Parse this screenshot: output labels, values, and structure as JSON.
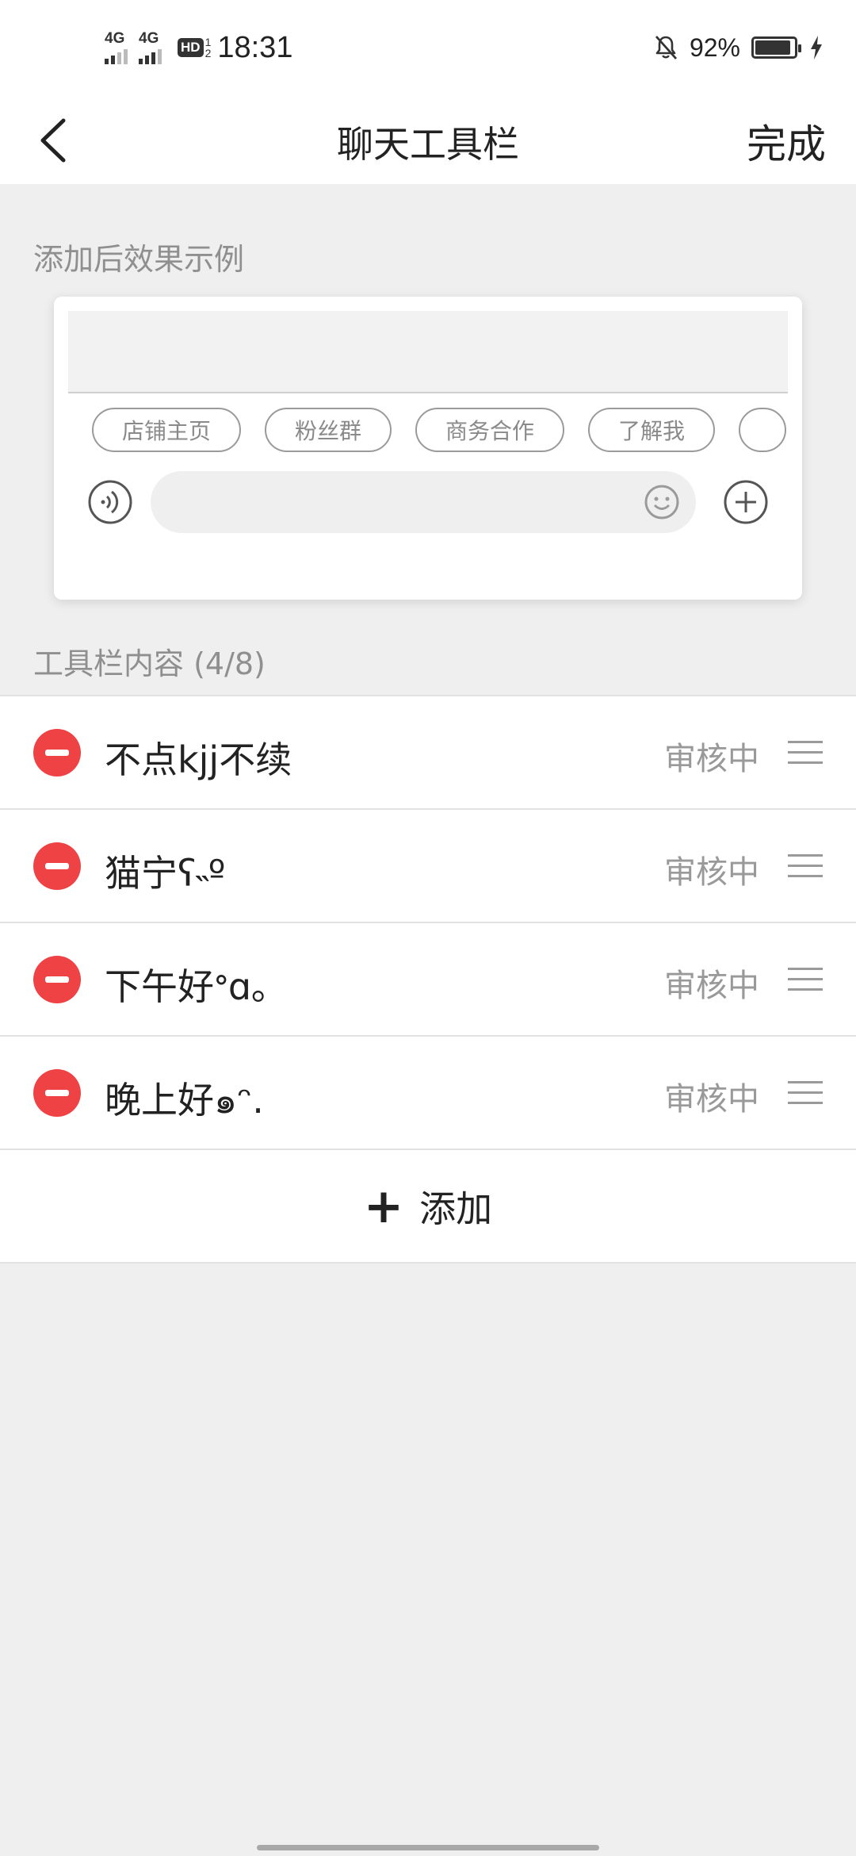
{
  "status_bar": {
    "signal1_label": "4G",
    "signal2_label": "4G",
    "hd_label": "HD",
    "hd_fraction_top": "1",
    "hd_fraction_bottom": "2",
    "time": "18:31",
    "battery_percent": "92%",
    "icons": [
      "bell-off-icon",
      "battery-icon",
      "charging-icon"
    ]
  },
  "nav": {
    "title": "聊天工具栏",
    "done_label": "完成",
    "back_icon": "chevron-left-icon"
  },
  "preview": {
    "section_label": "添加后效果示例",
    "chips": [
      "店铺主页",
      "粉丝群",
      "商务合作",
      "了解我"
    ]
  },
  "toolbar_content": {
    "section_label": "工具栏内容 (4/8)",
    "items": [
      {
        "label": "不点kjj不续",
        "status": "审核中"
      },
      {
        "label": "猫宁ʕ˵º",
        "status": "审核中"
      },
      {
        "label": "下午好ᐤɑ｡",
        "status": "审核中"
      },
      {
        "label": "晚上好๑ᵔ.",
        "status": "审核中"
      }
    ],
    "add_label": "添加"
  },
  "colors": {
    "delete_red": "#ee4245",
    "background": "#efefef",
    "muted_text": "#999999"
  }
}
